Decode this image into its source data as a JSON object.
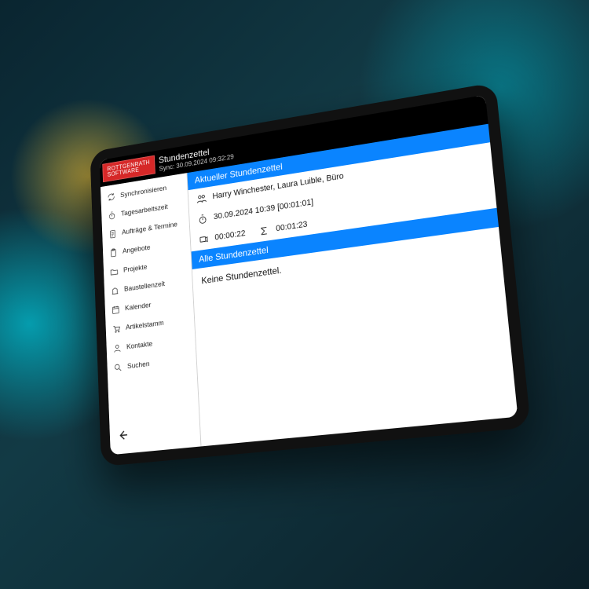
{
  "logo": {
    "line1": "Rottgenrath",
    "line2": "Software"
  },
  "header": {
    "title": "Stundenzettel",
    "sync_label": "Sync:",
    "sync_time": "30.09.2024 09:32:29"
  },
  "sidebar": {
    "items": [
      {
        "label": "Synchronisieren"
      },
      {
        "label": "Tagesarbeitszeit"
      },
      {
        "label": "Aufträge & Termine"
      },
      {
        "label": "Angebote"
      },
      {
        "label": "Projekte"
      },
      {
        "label": "Baustellenzeit"
      },
      {
        "label": "Kalender"
      },
      {
        "label": "Artikelstamm"
      },
      {
        "label": "Kontakte"
      },
      {
        "label": "Suchen"
      }
    ]
  },
  "sections": {
    "current_title": "Aktueller Stundenzettel",
    "all_title": "Alle Stundenzettel"
  },
  "current": {
    "people": "Harry Winchester, Laura Luible, Büro",
    "time_line": "30.09.2024 10:39 [00:01:01]",
    "elapsed": "00:00:22",
    "sum": "00:01:23"
  },
  "all": {
    "empty_text": "Keine Stundenzettel."
  }
}
